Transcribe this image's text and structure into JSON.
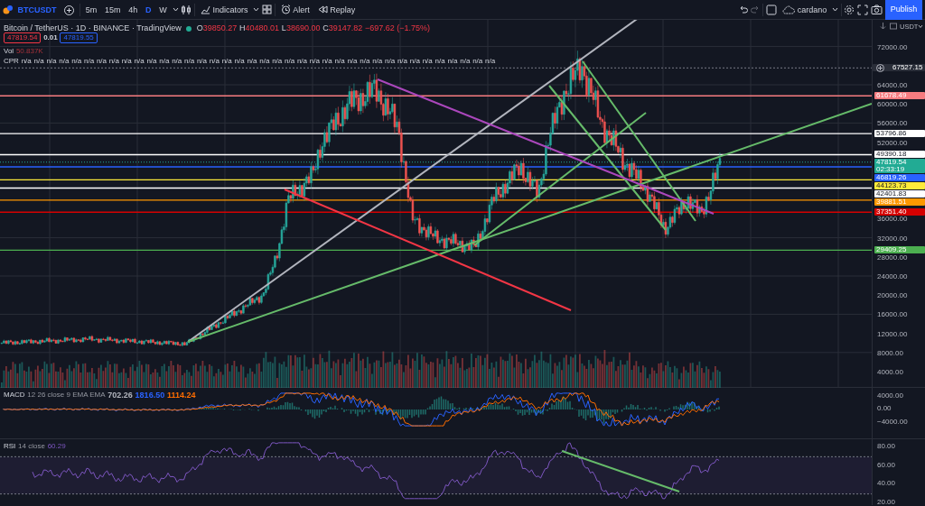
{
  "toolbar": {
    "symbol": "BTCUSDT",
    "intervals": [
      {
        "label": "5m",
        "selected": false
      },
      {
        "label": "15m",
        "selected": false
      },
      {
        "label": "4h",
        "selected": false
      },
      {
        "label": "D",
        "selected": true
      },
      {
        "label": "W",
        "selected": false
      }
    ],
    "indicators_label": "Indicators",
    "alert_label": "Alert",
    "replay_label": "Replay",
    "layout_name": "cardano",
    "publish_label": "Publish"
  },
  "legend": {
    "title": "Bitcoin / TetherUS · 1D · BINANCE · TradingView",
    "ohlc": [
      {
        "label": "O",
        "value": "39850.27"
      },
      {
        "label": "H",
        "value": "40480.01"
      },
      {
        "label": "L",
        "value": "38690.00"
      },
      {
        "label": "C",
        "value": "39147.82"
      }
    ],
    "change": "−697.62 (−1.75%)",
    "sell_price": "47819.54",
    "spread": "0.01",
    "buy_price": "47819.55",
    "volume": {
      "label": "Vol",
      "value": "50.837K"
    },
    "cpr": {
      "label": "CPR",
      "values": [
        "n/a",
        "n/a",
        "n/a",
        "n/a",
        "n/a",
        "n/a",
        "n/a",
        "n/a",
        "n/a",
        "n/a",
        "n/a",
        "n/a",
        "n/a",
        "n/a",
        "n/a",
        "n/a",
        "n/a",
        "n/a",
        "n/a",
        "n/a",
        "n/a",
        "n/a",
        "n/a",
        "n/a",
        "n/a",
        "n/a",
        "n/a",
        "n/a",
        "n/a",
        "n/a",
        "n/a",
        "n/a",
        "n/a",
        "n/a",
        "n/a",
        "n/a",
        "n/a",
        "n/a"
      ]
    }
  },
  "price_axis": {
    "currency": "USDT",
    "ticks": [
      "72000.00",
      "64000.00",
      "60000.00",
      "56000.00",
      "52000.00",
      "36000.00",
      "32000.00",
      "28000.00",
      "24000.00",
      "20000.00",
      "16000.00",
      "12000.00",
      "8000.00",
      "4000.00"
    ],
    "labels": [
      {
        "text": "67527.15",
        "kind": "crosshair",
        "color": "#2a2e39"
      },
      {
        "text": "61678.49",
        "kind": "level",
        "color": "#f77c80"
      },
      {
        "text": "53796.86",
        "kind": "level",
        "color": "#ffffff"
      },
      {
        "text": "49390.18",
        "kind": "level",
        "color": "#ffffff"
      },
      {
        "text": "47819.54",
        "kind": "last",
        "color": "#22ab94",
        "countdown": "02:33:19"
      },
      {
        "text": "46819.26",
        "kind": "level",
        "color": "#2962ff"
      },
      {
        "text": "44123.73",
        "kind": "level",
        "color": "#ffeb3b"
      },
      {
        "text": "42401.83",
        "kind": "level",
        "color": "#ffffff"
      },
      {
        "text": "39881.51",
        "kind": "level",
        "color": "#ff9800"
      },
      {
        "text": "37351.40",
        "kind": "level",
        "color": "#d50000"
      },
      {
        "text": "29409.25",
        "kind": "level",
        "color": "#4caf50"
      }
    ]
  },
  "macd": {
    "label": "MACD",
    "params": "12 26 close 9 EMA EMA",
    "values": [
      {
        "text": "702.26",
        "color": "#b2b5be"
      },
      {
        "text": "1816.50",
        "color": "#2962ff"
      },
      {
        "text": "1114.24",
        "color": "#ff6d00"
      }
    ],
    "ticks": [
      "4000.00",
      "0.00",
      "−4000.00"
    ]
  },
  "rsi": {
    "label": "RSI",
    "params": "14 close",
    "value": "60.29",
    "ticks": [
      "80.00",
      "60.00",
      "40.00",
      "20.00"
    ]
  }
}
